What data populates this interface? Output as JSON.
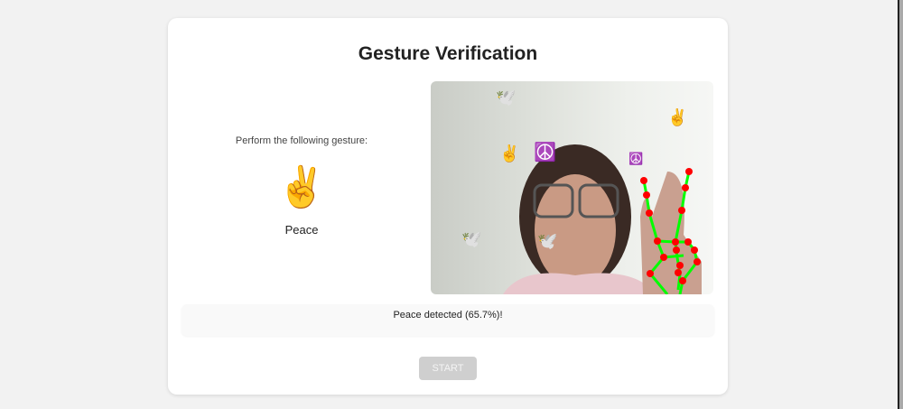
{
  "title": "Gesture Verification",
  "prompt": "Perform the following gesture:",
  "gesture": {
    "emoji": "✌️",
    "name": "Peace"
  },
  "status": "Peace detected (65.7%)!",
  "start_label": "START",
  "colors": {
    "landmark": "#ff0000",
    "connection": "#00ff00",
    "button_disabled": "#cfcfcf"
  }
}
